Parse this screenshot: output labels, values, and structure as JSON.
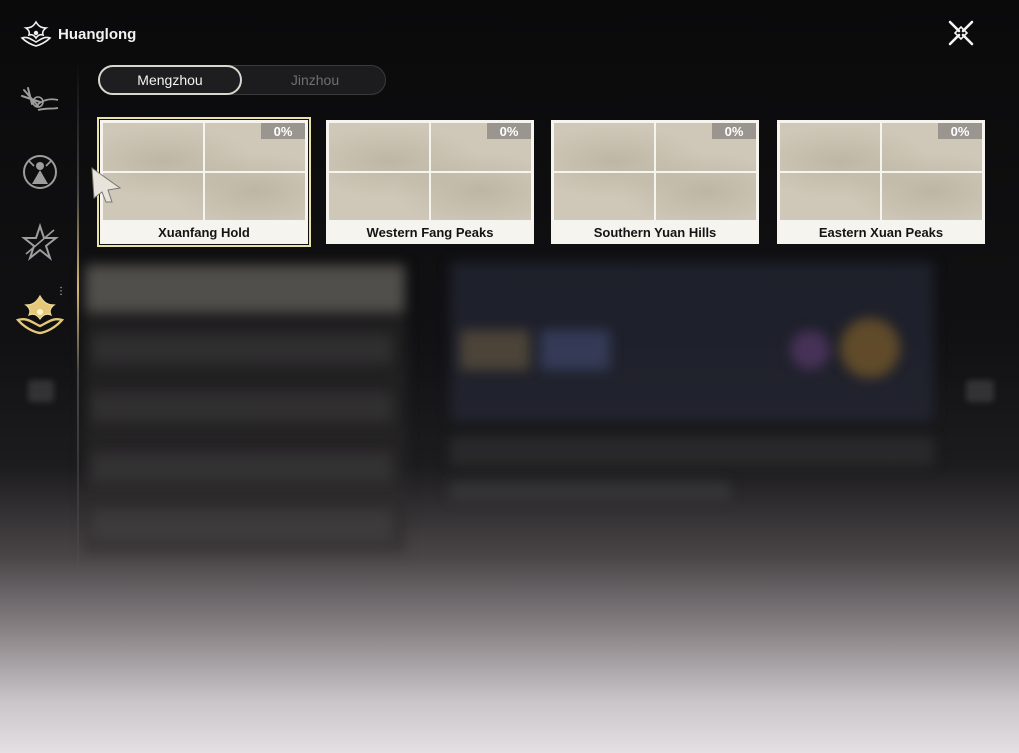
{
  "brand": {
    "title": "Huanglong",
    "icon": "huanglong-emblem-icon"
  },
  "tabs": [
    {
      "label": "Mengzhou",
      "active": true
    },
    {
      "label": "Jinzhou",
      "active": false
    }
  ],
  "regions": [
    {
      "name": "Xuanfang Hold",
      "progress": "0%",
      "selected": true
    },
    {
      "name": "Western Fang Peaks",
      "progress": "0%",
      "selected": false
    },
    {
      "name": "Southern Yuan Hills",
      "progress": "0%",
      "selected": false
    },
    {
      "name": "Eastern Xuan Peaks",
      "progress": "0%",
      "selected": false
    }
  ],
  "sidebar": {
    "items": [
      {
        "icon": "swordsman-emblem-icon"
      },
      {
        "icon": "figure-emblem-icon"
      },
      {
        "icon": "star-emblem-icon"
      },
      {
        "icon": "huanglong-emblem-icon",
        "active": true
      }
    ]
  },
  "close": {
    "icon": "close-icon"
  },
  "colors": {
    "selected_outline": "#e9e1a6",
    "card_bg": "#f6f4ef",
    "badge_bg": "#9a968f",
    "accent_gold": "#e6c87a"
  }
}
